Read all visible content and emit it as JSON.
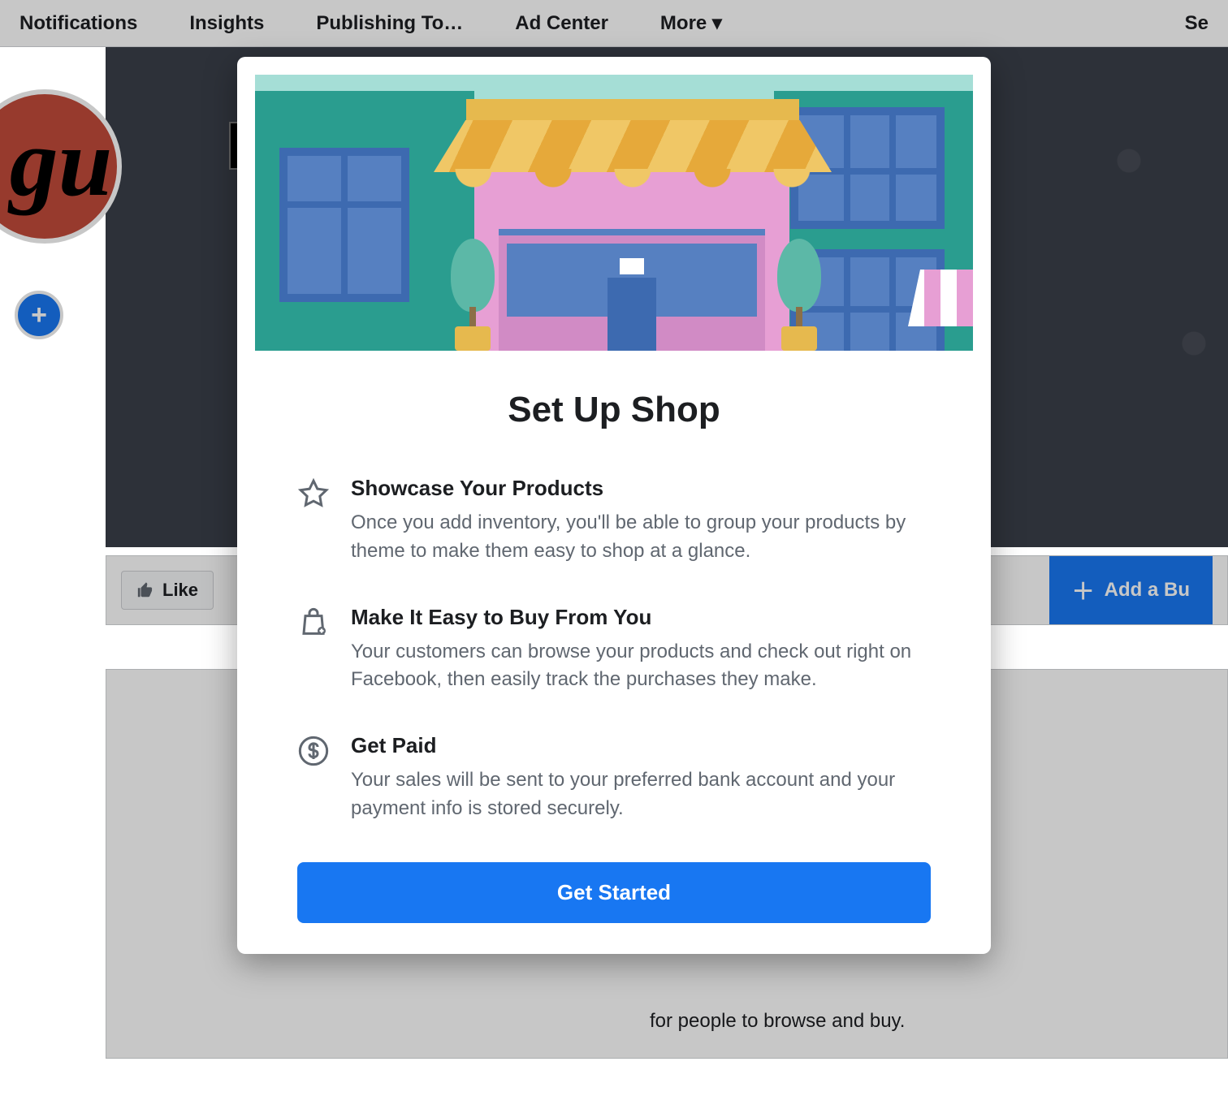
{
  "nav": {
    "items": [
      "Notifications",
      "Insights",
      "Publishing To…",
      "Ad Center",
      "More ▾"
    ],
    "right": "Se"
  },
  "cover": {
    "add_label": "Add"
  },
  "actions": {
    "like_label": "Like",
    "add_button_label": "Add a Bu"
  },
  "hint": "for people to browse and buy.",
  "modal": {
    "title": "Set Up Shop",
    "features": [
      {
        "title": "Showcase Your Products",
        "desc": "Once you add inventory, you'll be able to group your products by theme to make them easy to shop at a glance."
      },
      {
        "title": "Make It Easy to Buy From You",
        "desc": "Your customers can browse your products and check out right on Facebook, then easily track the purchases they make."
      },
      {
        "title": "Get Paid",
        "desc": "Your sales will be sent to your preferred bank account and your payment info is stored securely."
      }
    ],
    "cta": "Get Started"
  }
}
